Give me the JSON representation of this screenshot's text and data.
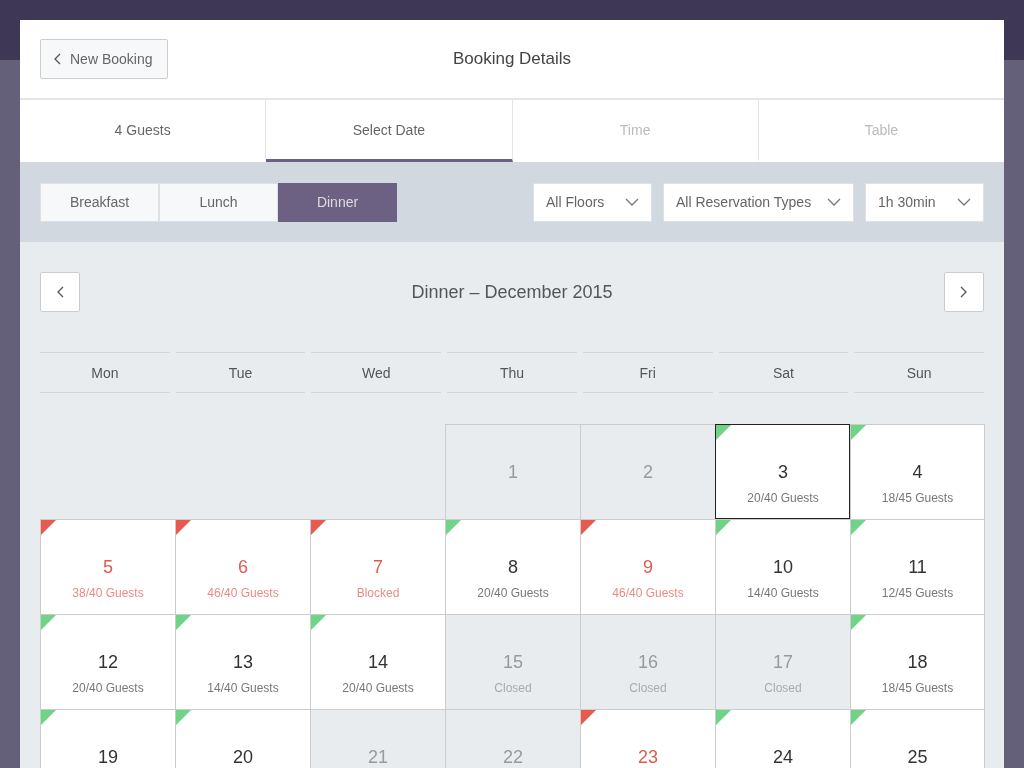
{
  "header": {
    "back_button": "New Booking",
    "title": "Booking Details"
  },
  "tabs": [
    {
      "label": "4 Guests",
      "selected": false,
      "disabled": false
    },
    {
      "label": "Select Date",
      "selected": true,
      "disabled": false
    },
    {
      "label": "Time",
      "selected": false,
      "disabled": true
    },
    {
      "label": "Table",
      "selected": false,
      "disabled": true
    }
  ],
  "meals": [
    {
      "label": "Breakfast",
      "selected": false
    },
    {
      "label": "Lunch",
      "selected": false
    },
    {
      "label": "Dinner",
      "selected": true
    }
  ],
  "filters": [
    "All Floors",
    "All Reservation Types",
    "1h 30min"
  ],
  "calendar": {
    "title": "Dinner – December 2015",
    "weekdays": [
      "Mon",
      "Tue",
      "Wed",
      "Thu",
      "Fri",
      "Sat",
      "Sun"
    ],
    "cells": [
      {
        "kind": "empty"
      },
      {
        "kind": "empty"
      },
      {
        "kind": "empty"
      },
      {
        "kind": "closed",
        "day": "1"
      },
      {
        "kind": "closed",
        "day": "2"
      },
      {
        "kind": "open",
        "day": "3",
        "info": "20/40 Guests",
        "color": "#6fd486",
        "warning": false,
        "selected": true
      },
      {
        "kind": "open",
        "day": "4",
        "info": "18/45 Guests",
        "color": "#6fd486",
        "warning": false,
        "selected": false
      },
      {
        "kind": "open",
        "day": "5",
        "info": "38/40 Guests",
        "color": "#e8594f",
        "warning": true,
        "selected": false
      },
      {
        "kind": "open",
        "day": "6",
        "info": "46/40 Guests",
        "color": "#e8594f",
        "warning": true,
        "selected": false
      },
      {
        "kind": "open",
        "day": "7",
        "info": "Blocked",
        "color": "#e8594f",
        "warning": true,
        "selected": false
      },
      {
        "kind": "open",
        "day": "8",
        "info": "20/40 Guests",
        "color": "#6fd486",
        "warning": false,
        "selected": false
      },
      {
        "kind": "open",
        "day": "9",
        "info": "46/40 Guests",
        "color": "#e8594f",
        "warning": true,
        "selected": false
      },
      {
        "kind": "open",
        "day": "10",
        "info": "14/40 Guests",
        "color": "#6fd486",
        "warning": false,
        "selected": false
      },
      {
        "kind": "open",
        "day": "11",
        "info": "12/45 Guests",
        "color": "#6fd486",
        "warning": false,
        "selected": false
      },
      {
        "kind": "open",
        "day": "12",
        "info": "20/40 Guests",
        "color": "#6fd486",
        "warning": false,
        "selected": false
      },
      {
        "kind": "open",
        "day": "13",
        "info": "14/40 Guests",
        "color": "#6fd486",
        "warning": false,
        "selected": false
      },
      {
        "kind": "open",
        "day": "14",
        "info": "20/40 Guests",
        "color": "#6fd486",
        "warning": false,
        "selected": false
      },
      {
        "kind": "closed",
        "day": "15",
        "info": "Closed"
      },
      {
        "kind": "closed",
        "day": "16",
        "info": "Closed"
      },
      {
        "kind": "closed",
        "day": "17",
        "info": "Closed"
      },
      {
        "kind": "open",
        "day": "18",
        "info": "18/45 Guests",
        "color": "#6fd486",
        "warning": false,
        "selected": false
      },
      {
        "kind": "open",
        "day": "19",
        "color": "#6fd486",
        "warning": false,
        "selected": false
      },
      {
        "kind": "open",
        "day": "20",
        "color": "#6fd486",
        "warning": false,
        "selected": false
      },
      {
        "kind": "closed",
        "day": "21"
      },
      {
        "kind": "closed",
        "day": "22"
      },
      {
        "kind": "open",
        "day": "23",
        "color": "#e8594f",
        "warning": true,
        "selected": false
      },
      {
        "kind": "open",
        "day": "24",
        "color": "#6fd486",
        "warning": false,
        "selected": false
      },
      {
        "kind": "open",
        "day": "25",
        "color": "#6fd486",
        "warning": false,
        "selected": false
      }
    ]
  }
}
